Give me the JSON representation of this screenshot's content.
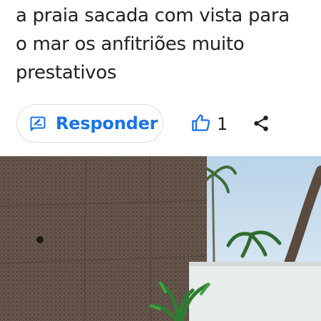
{
  "review": {
    "lines": [
      "a praia sacada com vista para",
      "o mar os anfitriões muito",
      "prestativos"
    ]
  },
  "actions": {
    "reply_label": "Responder",
    "like_count": "1",
    "icons": {
      "reply": "reply-edit-icon",
      "like": "thumbs-up-icon",
      "share": "share-icon"
    },
    "accent_color": "#1a73e8"
  },
  "photo": {
    "subject": "review-photo"
  }
}
